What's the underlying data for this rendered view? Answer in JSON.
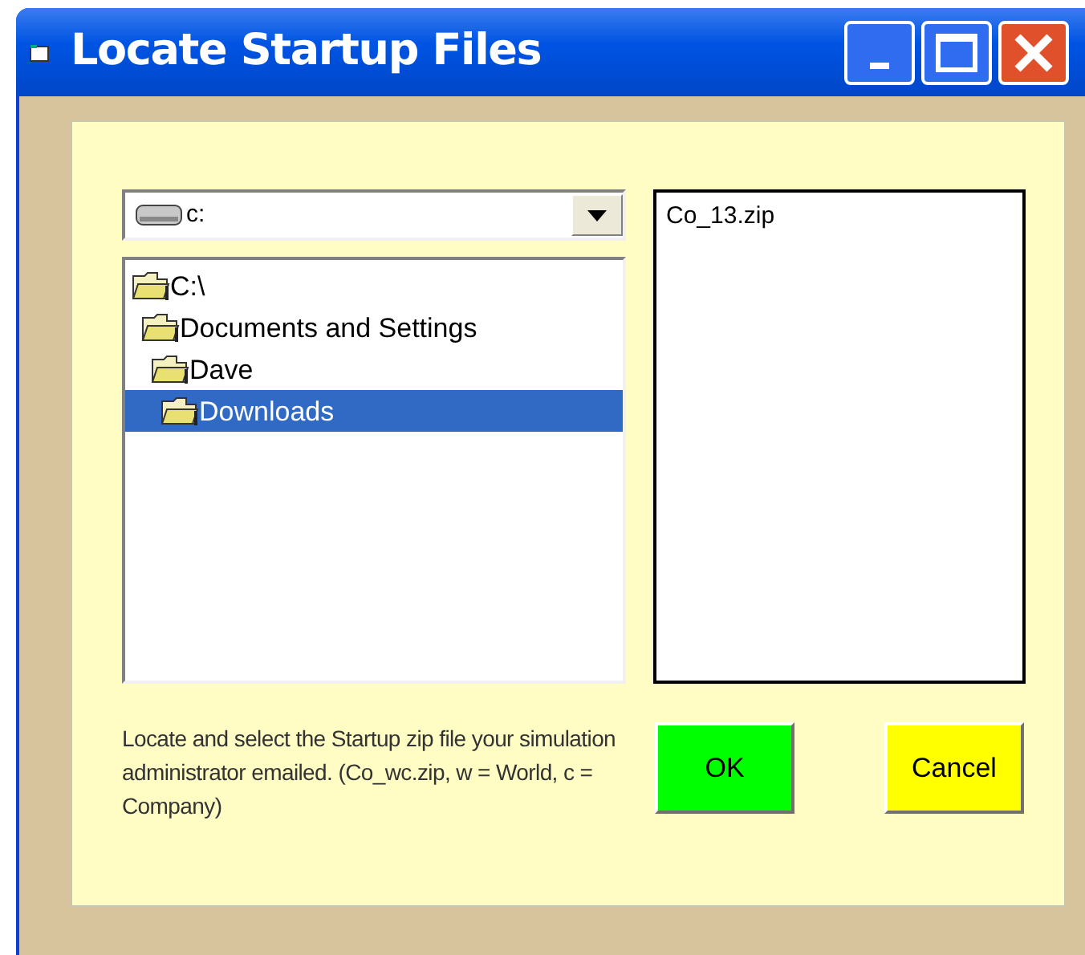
{
  "window": {
    "title": "Locate Startup Files"
  },
  "drive": {
    "value": "c:"
  },
  "folders": [
    {
      "name": "C:\\",
      "selected": false,
      "children": [
        {
          "name": "Documents and Settings",
          "selected": false,
          "children": [
            {
              "name": "Dave",
              "selected": false,
              "children": [
                {
                  "name": "Downloads",
                  "selected": true
                }
              ]
            }
          ]
        }
      ]
    }
  ],
  "files": [
    {
      "name": "Co_13.zip",
      "selected": false
    }
  ],
  "instructions": "Locate and select the Startup zip file your simulation administrator emailed. (Co_wc.zip, w = World, c = Company)",
  "buttons": [
    {
      "label": "OK",
      "color": "#00ff00"
    },
    {
      "label": "Cancel",
      "color": "#ffff00"
    }
  ]
}
